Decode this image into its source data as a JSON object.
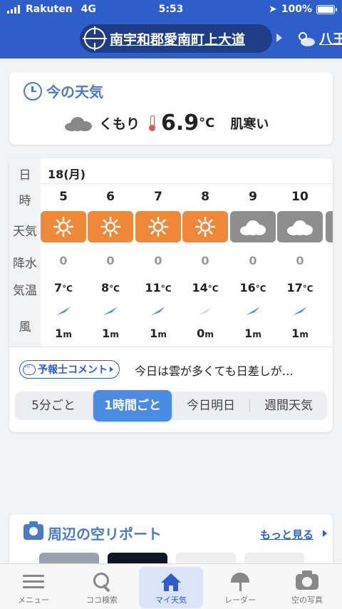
{
  "status_bar": {
    "carrier": "Rakuten",
    "network": "4G",
    "time": "5:53",
    "battery": "100%"
  },
  "header": {
    "location": "南宇和郡愛南町上大道",
    "next_location": "八王"
  },
  "now": {
    "title": "今の天気",
    "condition": "くもり",
    "temp": "6.9",
    "unit": "°C",
    "feel": "肌寒い"
  },
  "forecast": {
    "labels": {
      "date": "日",
      "hour": "時",
      "weather": "天気",
      "rain": "降水",
      "temp": "気温",
      "wind": "風"
    },
    "date": "18(月)",
    "hours": [
      {
        "hour": "5",
        "weather": "sunny",
        "rain": "0",
        "temp": "7",
        "wind": "1"
      },
      {
        "hour": "6",
        "weather": "sunny",
        "rain": "0",
        "temp": "8",
        "wind": "1"
      },
      {
        "hour": "7",
        "weather": "sunny",
        "rain": "0",
        "temp": "11",
        "wind": "1"
      },
      {
        "hour": "8",
        "weather": "sunny",
        "rain": "0",
        "temp": "14",
        "wind": "0"
      },
      {
        "hour": "9",
        "weather": "cloudy",
        "rain": "0",
        "temp": "16",
        "wind": "1"
      },
      {
        "hour": "10",
        "weather": "cloudy",
        "rain": "0",
        "temp": "17",
        "wind": "1"
      }
    ],
    "temp_unit": "°C",
    "wind_unit": "m",
    "comment_button": "予報士コメント",
    "comment_text": "今日は雲が多くても日差しが…",
    "tabs": [
      "5分ごと",
      "1時間ごと",
      "今日明日",
      "週間天気"
    ],
    "active_tab": "1時間ごと"
  },
  "report": {
    "title": "周辺の空リポート",
    "more": "もっと見る"
  },
  "nav": [
    {
      "label": "メニュー",
      "icon": "menu-icon"
    },
    {
      "label": "ココ検索",
      "icon": "search-icon"
    },
    {
      "label": "マイ天気",
      "icon": "home-icon"
    },
    {
      "label": "レーダー",
      "icon": "radar-icon"
    },
    {
      "label": "空の写真",
      "icon": "camera-icon"
    }
  ],
  "colors": {
    "header": "#2d5ec9",
    "sunny": "#f0883a",
    "cloudy": "#8e8e8e",
    "accent": "#4a8be4"
  }
}
